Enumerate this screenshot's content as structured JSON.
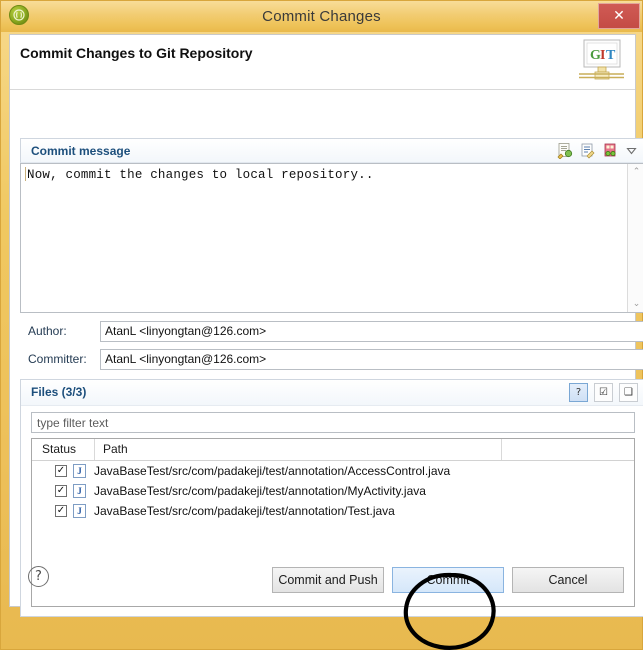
{
  "window": {
    "title": "Commit Changes",
    "title_icon": "git-app-icon",
    "close_label": "✕"
  },
  "header": {
    "title": "Commit Changes to Git Repository",
    "logo_letters": [
      "G",
      "I",
      "T"
    ],
    "logo_colors": [
      "#4b9b3e",
      "#c0392b",
      "#2e86c1"
    ]
  },
  "commit_message": {
    "section_title": "Commit message",
    "text": "Now, commit the changes to local repository..",
    "tools": [
      {
        "name": "amend-commit-icon"
      },
      {
        "name": "signed-off-by-icon"
      },
      {
        "name": "add-change-id-icon"
      },
      {
        "name": "chevron-down-icon"
      }
    ],
    "scroll_up": "⌃",
    "scroll_down": "⌄"
  },
  "fields": [
    {
      "label": "Author:",
      "value": "AtanL <linyongtan@126.com>",
      "name": "author"
    },
    {
      "label": "Committer:",
      "value": "AtanL <linyongtan@126.com>",
      "name": "committer"
    }
  ],
  "files": {
    "section_title": "Files (3/3)",
    "tools": [
      {
        "name": "show-untracked-files-button",
        "glyph": "?",
        "pressed": true
      },
      {
        "name": "select-all-button",
        "glyph": "☑",
        "pressed": false
      },
      {
        "name": "deselect-all-button",
        "glyph": "❑",
        "pressed": false
      }
    ],
    "filter_placeholder": "type filter text",
    "filter_value": "",
    "columns": [
      "Status",
      "Path"
    ],
    "rows": [
      {
        "checked": true,
        "icon": "java-file-icon",
        "icon_letter": "J",
        "path": "JavaBaseTest/src/com/padakeji/test/annotation/AccessControl.java"
      },
      {
        "checked": true,
        "icon": "java-file-icon",
        "icon_letter": "J",
        "path": "JavaBaseTest/src/com/padakeji/test/annotation/MyActivity.java"
      },
      {
        "checked": true,
        "icon": "java-file-icon",
        "icon_letter": "J",
        "path": "JavaBaseTest/src/com/padakeji/test/annotation/Test.java"
      }
    ]
  },
  "footer": {
    "help_glyph": "?",
    "buttons": [
      {
        "name": "commit-and-push-button",
        "label": "Commit and Push",
        "default": false
      },
      {
        "name": "commit-button",
        "label": "Commit",
        "default": true
      },
      {
        "name": "cancel-button",
        "label": "Cancel",
        "default": false
      }
    ]
  },
  "annotation": {
    "name": "hand-drawn-circle-around-commit",
    "color": "#000000"
  },
  "colors": {
    "titlebar": "#eec257",
    "accent_blue": "#1d4f7c",
    "close_red": "#c44c45"
  }
}
